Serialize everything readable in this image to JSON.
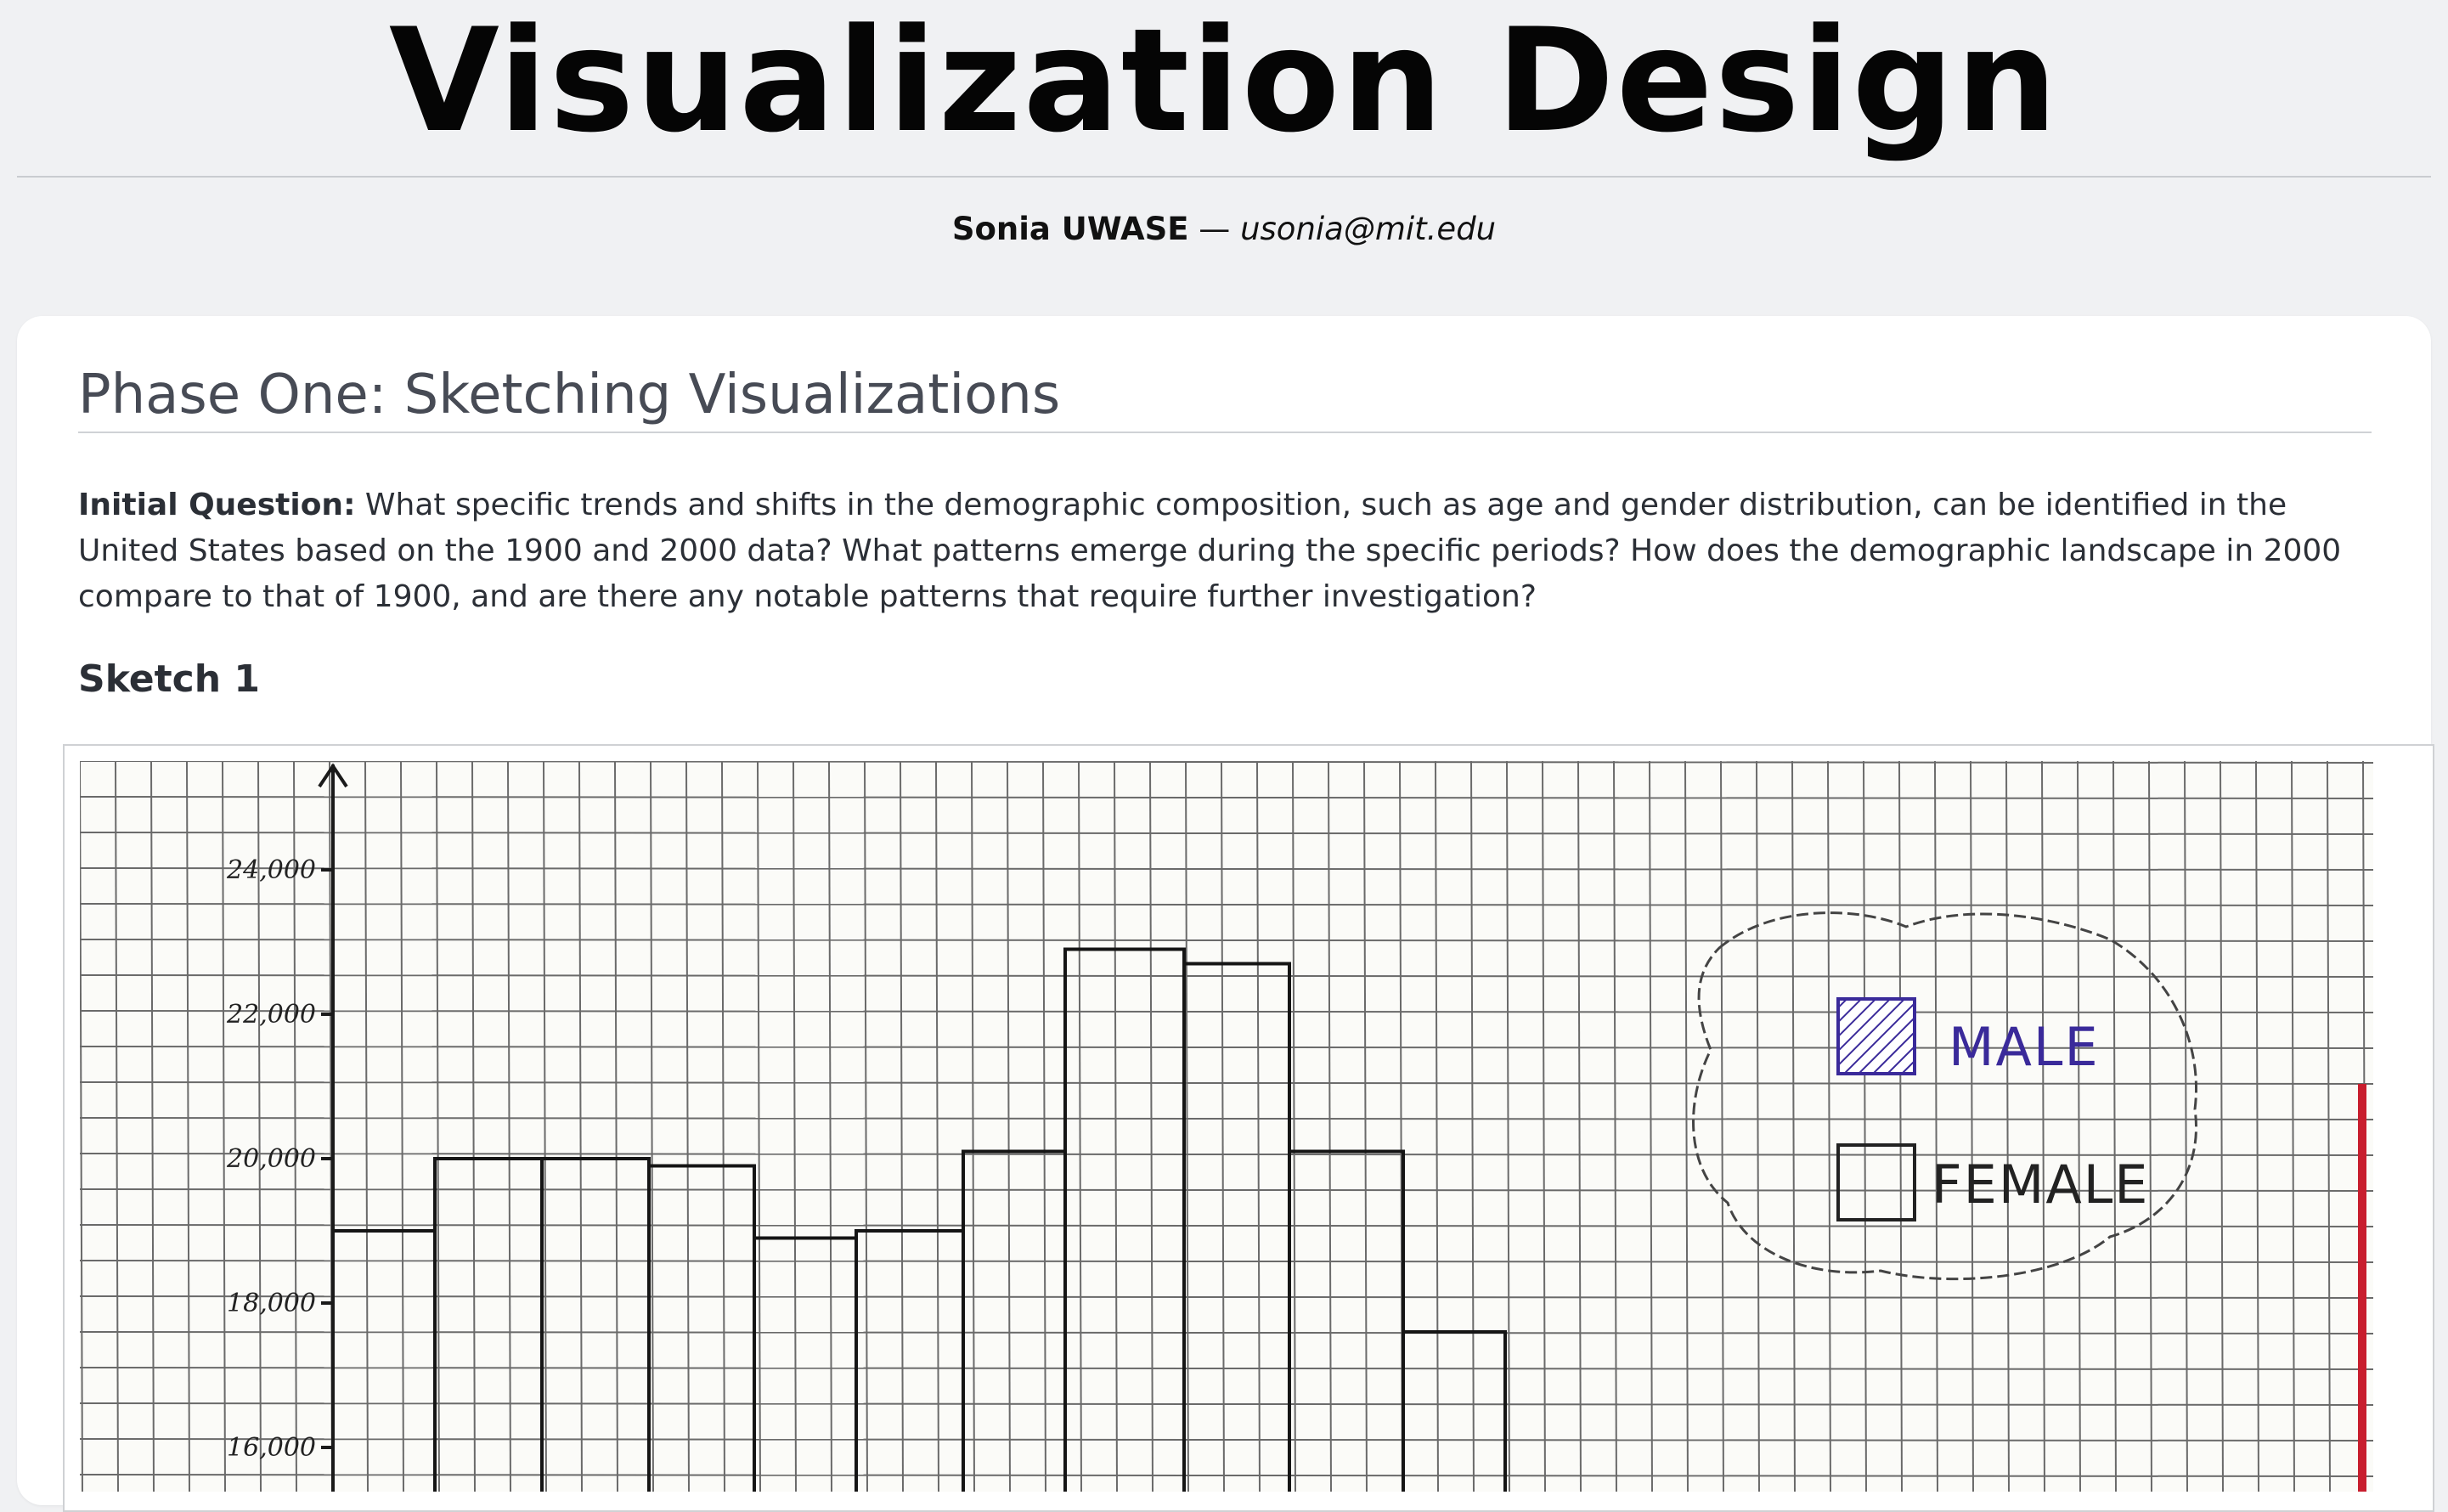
{
  "header": {
    "title": "Visualization Design",
    "author": "Sonia UWASE",
    "separator": " — ",
    "email": "usonia@mit.edu"
  },
  "section": {
    "title": "Phase One: Sketching Visualizations",
    "question_label": "Initial Question:",
    "question_text": " What specific trends and shifts in the demographic composition, such as age and gender distribution, can be identified in the United States based on the 1900 and 2000 data? What patterns emerge during the specific periods? How does the demographic landscape in 2000 compare to that of 1900, and are there any notable patterns that require further investigation?"
  },
  "sketch": {
    "title": "Sketch 1",
    "y_ticks": [
      "24,000",
      "22,000",
      "20,000",
      "18,000",
      "16,000"
    ],
    "legend": [
      "MALE",
      "FEMALE"
    ]
  },
  "chart_data": {
    "type": "bar",
    "y_ticks": [
      24000,
      22000,
      20000,
      18000,
      16000
    ],
    "bars": [
      19000,
      20000,
      20000,
      19900,
      18900,
      19000,
      20100,
      22900,
      22700,
      20100,
      17600
    ],
    "legend": [
      "MALE",
      "FEMALE"
    ],
    "legend_placement": "top-right",
    "grid": true
  },
  "colors": {
    "ink": "#1a1a1a",
    "grid": "#5a5a5a",
    "male_hatch": "#3a2a9a",
    "paper": "#fbfbf8"
  }
}
